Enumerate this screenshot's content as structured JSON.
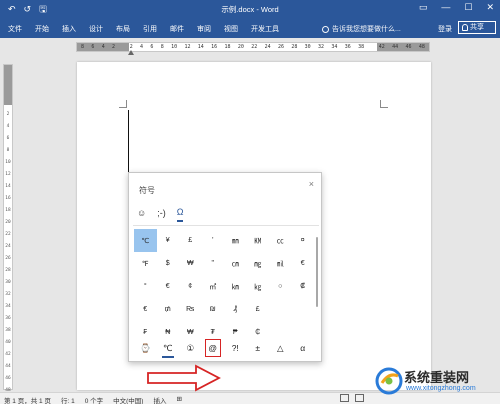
{
  "titlebar": {
    "qat": {
      "undo": "↶",
      "redo": "↺",
      "save": "🖫"
    },
    "title": "示例.docx - Word",
    "controls": {
      "restore": "▭",
      "minimize": "—",
      "maximize": "☐",
      "close": "✕"
    }
  },
  "ribbon": {
    "tabs": [
      "文件",
      "开始",
      "插入",
      "设计",
      "布局",
      "引用",
      "邮件",
      "审阅",
      "视图",
      "开发工具"
    ],
    "tell_me": "告诉我您想要做什么...",
    "login": "登录",
    "share": "共享"
  },
  "ruler": {
    "h_ticks": [
      "8",
      "6",
      "4",
      "2",
      "",
      "2",
      "4",
      "6",
      "8",
      "10",
      "12",
      "14",
      "16",
      "18",
      "20",
      "22",
      "24",
      "26",
      "28",
      "30",
      "32",
      "34",
      "36",
      "38",
      "",
      "42",
      "44",
      "46",
      "48"
    ],
    "v_ticks": [
      "2",
      "4",
      "6",
      "8",
      "10",
      "12",
      "14",
      "16",
      "18",
      "20",
      "22",
      "24",
      "26",
      "28",
      "30",
      "32",
      "34",
      "36",
      "38",
      "40",
      "42",
      "44",
      "46",
      "48"
    ]
  },
  "symbol_panel": {
    "title": "符号",
    "close": "×",
    "categories": [
      {
        "icon": "☺",
        "name": "emoji-icon"
      },
      {
        "icon": ";-)",
        "name": "kaomoji-icon"
      },
      {
        "icon": "Ω",
        "name": "symbol-icon",
        "active": true
      }
    ],
    "symbols": [
      "℃",
      "¥",
      "£",
      "'",
      "㎜",
      "㏎",
      "㏄",
      "¤",
      "℉",
      "$",
      "₩",
      "\"",
      "㎝",
      "㎎",
      "㏕",
      "€",
      "°",
      "€",
      "¢",
      "㎡",
      "㎞",
      "㎏",
      "○",
      "₡",
      "€",
      "₥",
      "₨",
      "₪",
      "₰",
      "£",
      "",
      "",
      "₣",
      "₦",
      "₩",
      "₮",
      "₱",
      "₵",
      "",
      ""
    ],
    "selected_index": 0,
    "recent": [
      "⌚",
      "℃",
      "①",
      "@",
      "?!",
      "±",
      "△",
      "α"
    ],
    "recent_underlined_index": 1,
    "recent_boxed_index": 3
  },
  "statusbar": {
    "page": "第 1 页，共 1 页",
    "line": "行: 1",
    "words": "0 个字",
    "language": "中文(中国)",
    "mode": "插入",
    "macro": "⊞"
  },
  "watermark": {
    "brand": "系统重装网",
    "url": "www.xitongzhong.com"
  },
  "colors": {
    "accent": "#2b579a",
    "selection": "#98c4ee",
    "annotation": "#d62424"
  }
}
